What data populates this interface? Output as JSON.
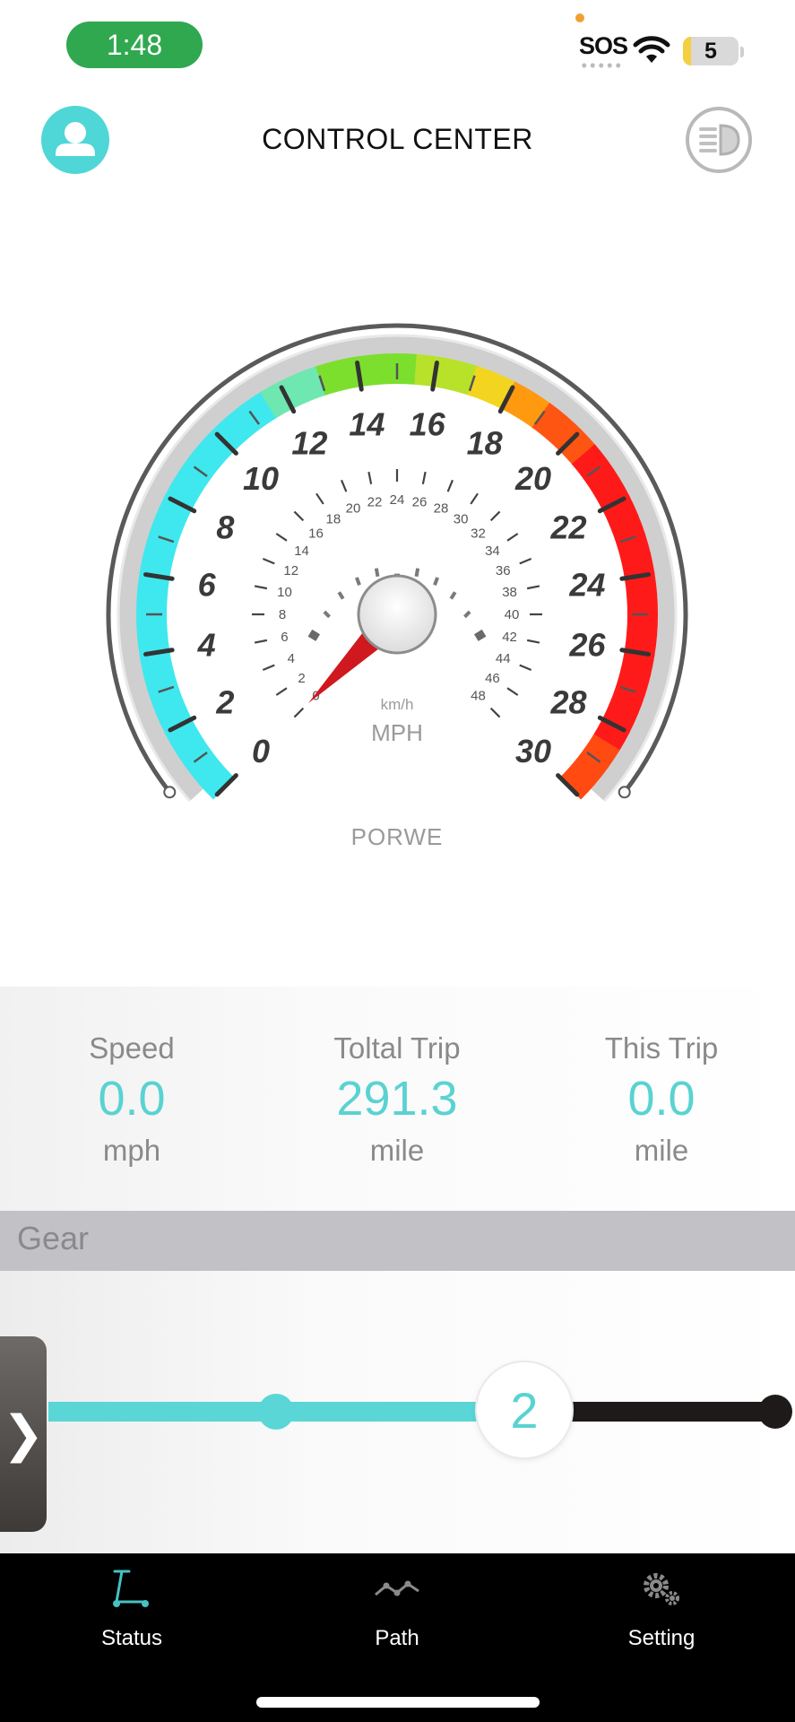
{
  "status_bar": {
    "time": "1:48",
    "sos": "SOS",
    "battery": "5",
    "colors": {
      "time_pill": "#2fa84f",
      "battery_fill": "#f4d03f",
      "privacy_dot": "#f0a030"
    }
  },
  "header": {
    "title": "CONTROL CENTER",
    "left_icon": "user-avatar-icon",
    "right_icon": "headlight-icon"
  },
  "gauge": {
    "mph_ticks": [
      "0",
      "2",
      "4",
      "6",
      "8",
      "10",
      "12",
      "14",
      "16",
      "18",
      "20",
      "22",
      "24",
      "26",
      "28",
      "30"
    ],
    "kmh_ticks": [
      "0",
      "2",
      "4",
      "6",
      "8",
      "10",
      "12",
      "14",
      "16",
      "18",
      "20",
      "22",
      "24",
      "26",
      "28",
      "30",
      "32",
      "34",
      "36",
      "38",
      "40",
      "42",
      "44",
      "46",
      "48"
    ],
    "unit_small": "km/h",
    "unit_main": "MPH",
    "brand": "PORWE",
    "needle_value": 0,
    "colors": {
      "low": "#3ee8ee",
      "mid": "#7cdf2e",
      "high": "#ff1a1a",
      "needle": "#d0181f"
    }
  },
  "stats": [
    {
      "label": "Speed",
      "value": "0.0",
      "unit": "mph"
    },
    {
      "label": "Toltal Trip",
      "value": "291.3",
      "unit": "mile"
    },
    {
      "label": "This Trip",
      "value": "0.0",
      "unit": "mile"
    }
  ],
  "gear": {
    "label": "Gear",
    "value": "2",
    "current_level": 2,
    "levels": 3,
    "colors": {
      "active": "#5ad6d6",
      "inactive": "#1e1a1a"
    }
  },
  "side_handle": {
    "icon": "chevron-right-icon",
    "glyph": "❯"
  },
  "tabs": [
    {
      "label": "Status",
      "icon": "scooter-icon",
      "active": true
    },
    {
      "label": "Path",
      "icon": "path-icon",
      "active": false
    },
    {
      "label": "Setting",
      "icon": "gears-icon",
      "active": false
    }
  ]
}
